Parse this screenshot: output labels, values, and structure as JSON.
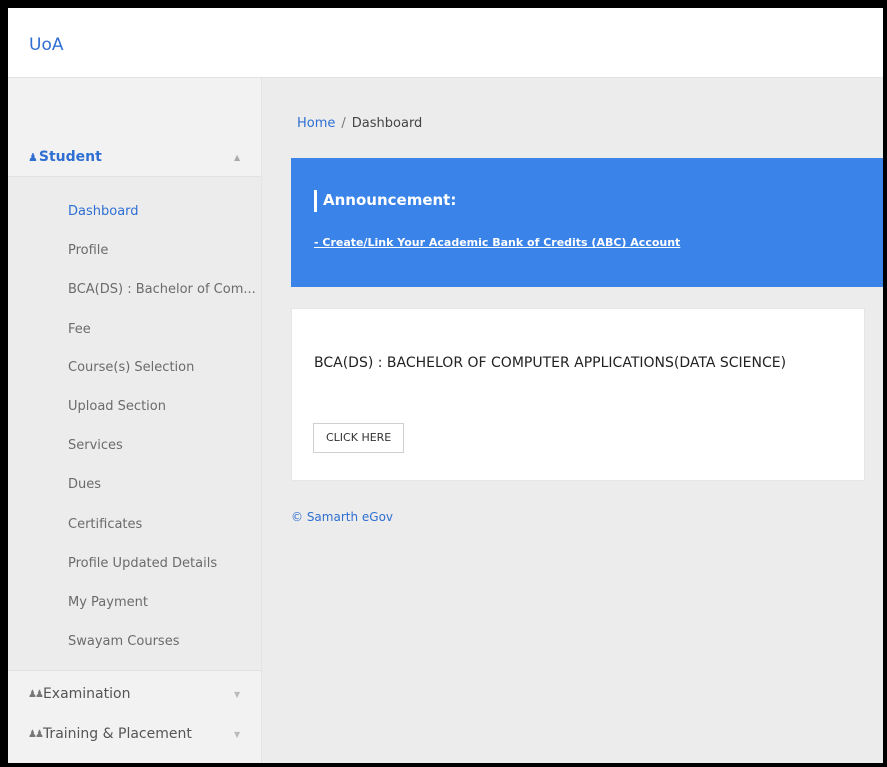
{
  "app": {
    "brand": "UoA"
  },
  "breadcrumb": {
    "home": "Home",
    "separator": "/",
    "current": "Dashboard"
  },
  "sidebar": {
    "student": {
      "label": "Student",
      "icon": "user-icon"
    },
    "items": [
      {
        "label": "Dashboard",
        "active": true
      },
      {
        "label": "Profile"
      },
      {
        "label": "BCA(DS) : Bachelor of Com..."
      },
      {
        "label": "Fee"
      },
      {
        "label": "Course(s) Selection"
      },
      {
        "label": "Upload Section"
      },
      {
        "label": "Services"
      },
      {
        "label": "Dues"
      },
      {
        "label": "Certificates"
      },
      {
        "label": "Profile Updated Details"
      },
      {
        "label": "My Payment"
      },
      {
        "label": "Swayam Courses"
      }
    ],
    "examination": {
      "label": "Examination",
      "icon": "users-icon"
    },
    "training": {
      "label": "Training & Placement",
      "icon": "users-icon"
    }
  },
  "announcement": {
    "title": "Announcement:",
    "link": "- Create/Link Your Academic Bank of Credits (ABC) Account"
  },
  "program_card": {
    "title": "BCA(DS) : BACHELOR OF COMPUTER APPLICATIONS(DATA SCIENCE)",
    "button": "CLICK HERE"
  },
  "footer": {
    "text": "© Samarth eGov"
  },
  "colors": {
    "accent": "#2f6fd2",
    "announcement_bg": "#3a83e8"
  }
}
